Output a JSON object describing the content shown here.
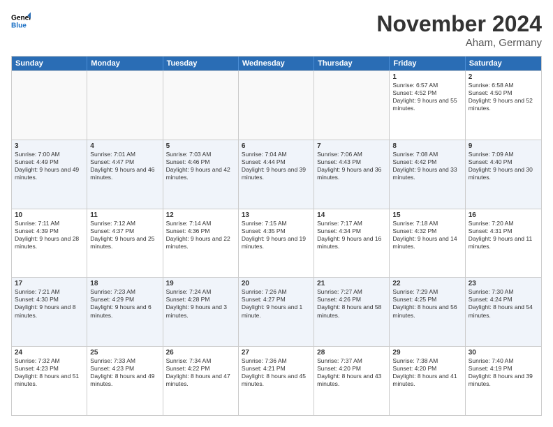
{
  "logo": {
    "line1": "General",
    "line2": "Blue"
  },
  "title": "November 2024",
  "location": "Aham, Germany",
  "header_days": [
    "Sunday",
    "Monday",
    "Tuesday",
    "Wednesday",
    "Thursday",
    "Friday",
    "Saturday"
  ],
  "rows": [
    [
      {
        "day": "",
        "info": ""
      },
      {
        "day": "",
        "info": ""
      },
      {
        "day": "",
        "info": ""
      },
      {
        "day": "",
        "info": ""
      },
      {
        "day": "",
        "info": ""
      },
      {
        "day": "1",
        "info": "Sunrise: 6:57 AM\nSunset: 4:52 PM\nDaylight: 9 hours and 55 minutes."
      },
      {
        "day": "2",
        "info": "Sunrise: 6:58 AM\nSunset: 4:50 PM\nDaylight: 9 hours and 52 minutes."
      }
    ],
    [
      {
        "day": "3",
        "info": "Sunrise: 7:00 AM\nSunset: 4:49 PM\nDaylight: 9 hours and 49 minutes."
      },
      {
        "day": "4",
        "info": "Sunrise: 7:01 AM\nSunset: 4:47 PM\nDaylight: 9 hours and 46 minutes."
      },
      {
        "day": "5",
        "info": "Sunrise: 7:03 AM\nSunset: 4:46 PM\nDaylight: 9 hours and 42 minutes."
      },
      {
        "day": "6",
        "info": "Sunrise: 7:04 AM\nSunset: 4:44 PM\nDaylight: 9 hours and 39 minutes."
      },
      {
        "day": "7",
        "info": "Sunrise: 7:06 AM\nSunset: 4:43 PM\nDaylight: 9 hours and 36 minutes."
      },
      {
        "day": "8",
        "info": "Sunrise: 7:08 AM\nSunset: 4:42 PM\nDaylight: 9 hours and 33 minutes."
      },
      {
        "day": "9",
        "info": "Sunrise: 7:09 AM\nSunset: 4:40 PM\nDaylight: 9 hours and 30 minutes."
      }
    ],
    [
      {
        "day": "10",
        "info": "Sunrise: 7:11 AM\nSunset: 4:39 PM\nDaylight: 9 hours and 28 minutes."
      },
      {
        "day": "11",
        "info": "Sunrise: 7:12 AM\nSunset: 4:37 PM\nDaylight: 9 hours and 25 minutes."
      },
      {
        "day": "12",
        "info": "Sunrise: 7:14 AM\nSunset: 4:36 PM\nDaylight: 9 hours and 22 minutes."
      },
      {
        "day": "13",
        "info": "Sunrise: 7:15 AM\nSunset: 4:35 PM\nDaylight: 9 hours and 19 minutes."
      },
      {
        "day": "14",
        "info": "Sunrise: 7:17 AM\nSunset: 4:34 PM\nDaylight: 9 hours and 16 minutes."
      },
      {
        "day": "15",
        "info": "Sunrise: 7:18 AM\nSunset: 4:32 PM\nDaylight: 9 hours and 14 minutes."
      },
      {
        "day": "16",
        "info": "Sunrise: 7:20 AM\nSunset: 4:31 PM\nDaylight: 9 hours and 11 minutes."
      }
    ],
    [
      {
        "day": "17",
        "info": "Sunrise: 7:21 AM\nSunset: 4:30 PM\nDaylight: 9 hours and 8 minutes."
      },
      {
        "day": "18",
        "info": "Sunrise: 7:23 AM\nSunset: 4:29 PM\nDaylight: 9 hours and 6 minutes."
      },
      {
        "day": "19",
        "info": "Sunrise: 7:24 AM\nSunset: 4:28 PM\nDaylight: 9 hours and 3 minutes."
      },
      {
        "day": "20",
        "info": "Sunrise: 7:26 AM\nSunset: 4:27 PM\nDaylight: 9 hours and 1 minute."
      },
      {
        "day": "21",
        "info": "Sunrise: 7:27 AM\nSunset: 4:26 PM\nDaylight: 8 hours and 58 minutes."
      },
      {
        "day": "22",
        "info": "Sunrise: 7:29 AM\nSunset: 4:25 PM\nDaylight: 8 hours and 56 minutes."
      },
      {
        "day": "23",
        "info": "Sunrise: 7:30 AM\nSunset: 4:24 PM\nDaylight: 8 hours and 54 minutes."
      }
    ],
    [
      {
        "day": "24",
        "info": "Sunrise: 7:32 AM\nSunset: 4:23 PM\nDaylight: 8 hours and 51 minutes."
      },
      {
        "day": "25",
        "info": "Sunrise: 7:33 AM\nSunset: 4:23 PM\nDaylight: 8 hours and 49 minutes."
      },
      {
        "day": "26",
        "info": "Sunrise: 7:34 AM\nSunset: 4:22 PM\nDaylight: 8 hours and 47 minutes."
      },
      {
        "day": "27",
        "info": "Sunrise: 7:36 AM\nSunset: 4:21 PM\nDaylight: 8 hours and 45 minutes."
      },
      {
        "day": "28",
        "info": "Sunrise: 7:37 AM\nSunset: 4:20 PM\nDaylight: 8 hours and 43 minutes."
      },
      {
        "day": "29",
        "info": "Sunrise: 7:38 AM\nSunset: 4:20 PM\nDaylight: 8 hours and 41 minutes."
      },
      {
        "day": "30",
        "info": "Sunrise: 7:40 AM\nSunset: 4:19 PM\nDaylight: 8 hours and 39 minutes."
      }
    ]
  ]
}
